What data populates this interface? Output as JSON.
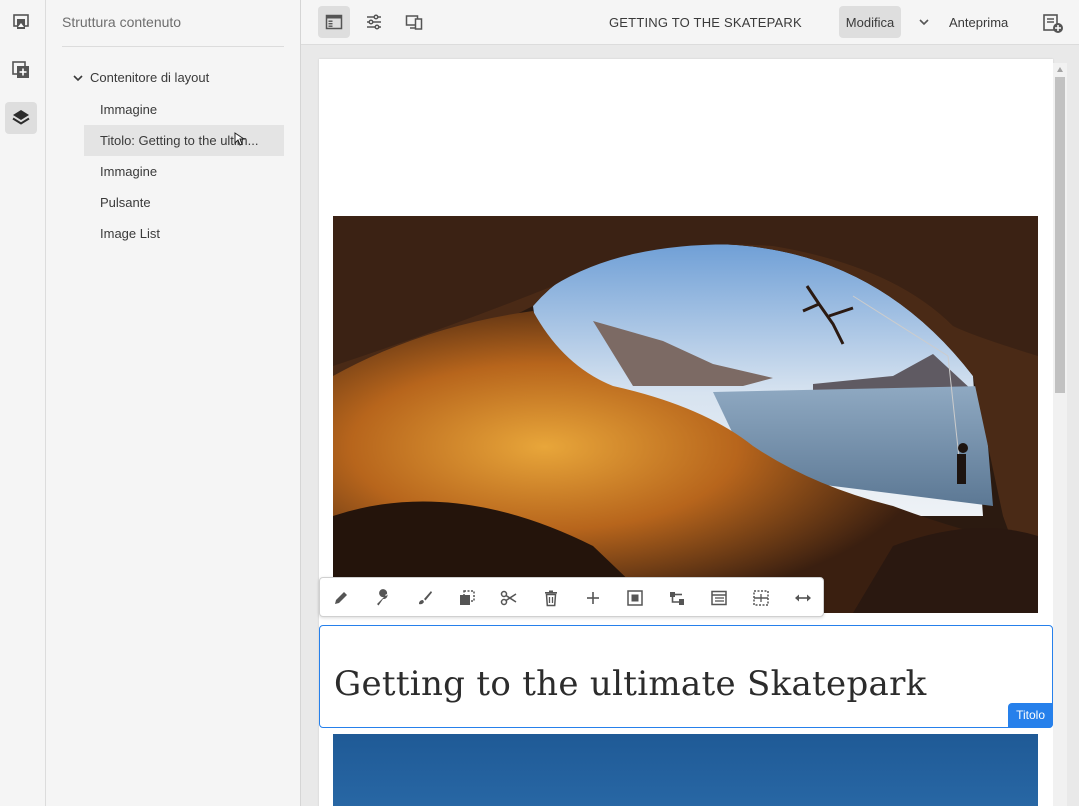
{
  "rail": {
    "items": [
      {
        "icon": "assets-icon"
      },
      {
        "icon": "components-icon"
      },
      {
        "icon": "content-tree-icon",
        "active": true
      }
    ]
  },
  "panel": {
    "title": "Struttura contenuto",
    "root": "Contenitore di layout",
    "items": [
      {
        "label": "Immagine"
      },
      {
        "label": "Titolo: Getting to the ultim..."
      },
      {
        "label": "Immagine"
      },
      {
        "label": "Pulsante"
      },
      {
        "label": "Image List"
      }
    ],
    "selected_index": 1
  },
  "toolbar": {
    "page_title": "GETTING TO THE SKATEPARK",
    "mode": "Modifica",
    "preview": "Anteprima"
  },
  "page": {
    "title": "Getting to the ultimate Skatepark",
    "title_badge": "Titolo"
  },
  "edit_toolbar": {
    "icons": [
      "pencil-icon",
      "wrench-icon",
      "brush-icon",
      "copy-icon",
      "scissors-icon",
      "trash-icon",
      "plus-icon",
      "group-icon",
      "parent-icon",
      "layout-icon",
      "insert-icon",
      "resize-icon"
    ]
  },
  "colors": {
    "accent": "#2680eb",
    "panel_bg": "#f5f5f5",
    "canvas_bg": "#e9e9e9"
  }
}
